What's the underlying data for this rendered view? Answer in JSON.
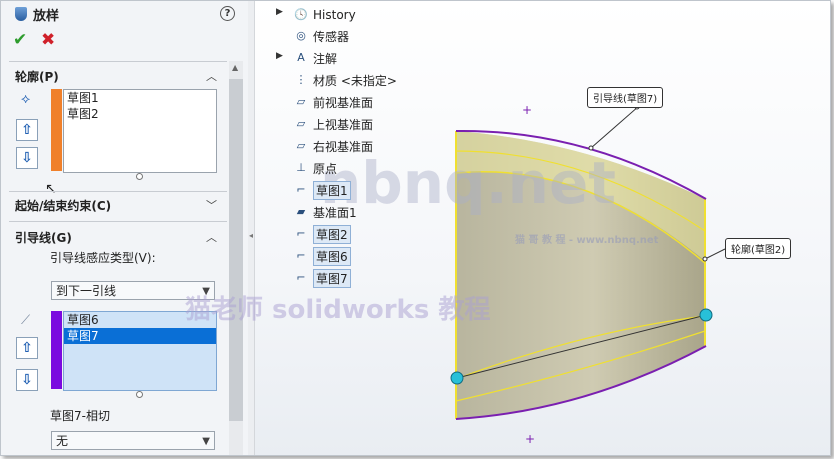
{
  "property_manager": {
    "title": "放样",
    "help": "?",
    "ok": "✔",
    "cancel": "✖",
    "profile_section": {
      "label": "轮廓(P)",
      "items": [
        "草图1",
        "草图2"
      ]
    },
    "constraints_section": {
      "label": "起始/结束约束(C)"
    },
    "guide_section": {
      "label": "引导线(G)",
      "influence_label": "引导线感应类型(V):",
      "influence_value": "到下一引线",
      "items": [
        "草图6",
        "草图7"
      ],
      "selected_item": "草图7",
      "tangency_label": "草图7-相切",
      "tangency_value": "无"
    }
  },
  "feature_tree": {
    "items": [
      {
        "label": "History",
        "icon": "history-icon"
      },
      {
        "label": "传感器",
        "icon": "sensor-icon"
      },
      {
        "label": "注解",
        "icon": "annotation-icon"
      },
      {
        "label": "材质 <未指定>",
        "icon": "material-icon"
      },
      {
        "label": "前视基准面",
        "icon": "plane-icon"
      },
      {
        "label": "上视基准面",
        "icon": "plane-icon"
      },
      {
        "label": "右视基准面",
        "icon": "plane-icon"
      },
      {
        "label": "原点",
        "icon": "origin-icon"
      },
      {
        "label": "草图1",
        "icon": "sketch-icon"
      },
      {
        "label": "基准面1",
        "icon": "plane-icon"
      },
      {
        "label": "草图2",
        "icon": "sketch-icon"
      },
      {
        "label": "草图6",
        "icon": "sketch-icon"
      },
      {
        "label": "草图7",
        "icon": "sketch-icon"
      }
    ]
  },
  "viewport": {
    "callout_guide": "引导线(草图7)",
    "callout_profile": "轮廓(草图2)",
    "watermark_main": "nbnq.net",
    "watermark_small": "猫 哥 教 程 - www.nbnq.net",
    "watermark_cn": "猫老师 solidworks 教程"
  },
  "colors": {
    "profile_bar": "#f0802a",
    "guide_bar": "#7a0adf",
    "selection": "#0a6fd6",
    "surface": "#b9b49a"
  }
}
